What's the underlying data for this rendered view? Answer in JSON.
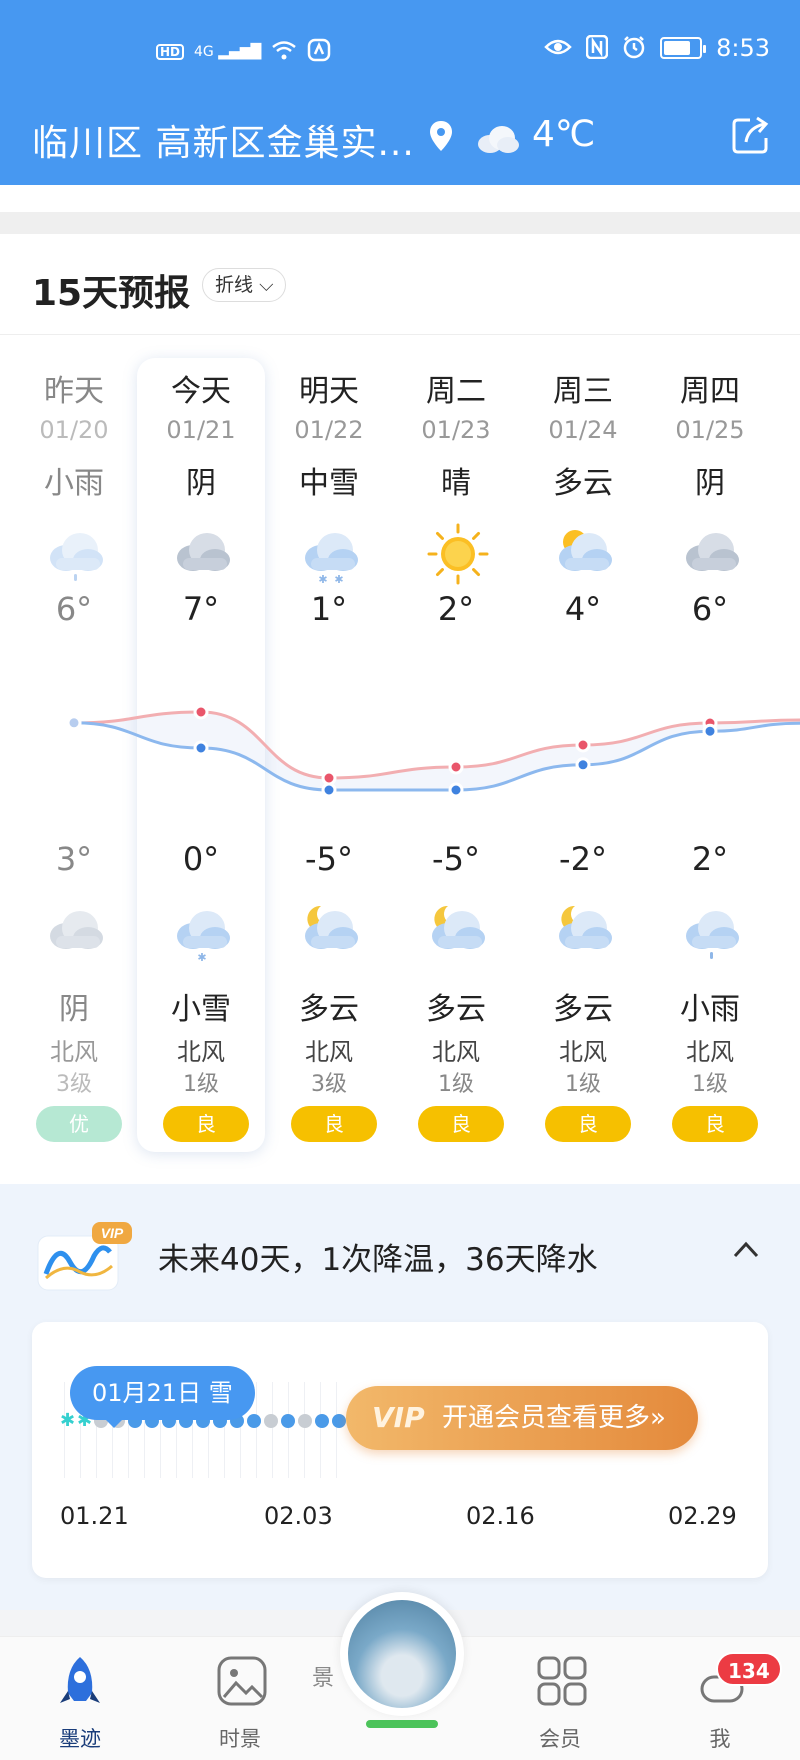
{
  "status_bar": {
    "time": "8:53",
    "left_icons": [
      "HD",
      "4G",
      "signal-icon",
      "wifi-icon",
      "vpn-icon"
    ],
    "right_icons": [
      "eye-icon",
      "nfc-icon",
      "alarm-icon",
      "battery-icon"
    ],
    "battery_level": 0.75
  },
  "header": {
    "location": "临川区 高新区金巢实...",
    "temperature": "4℃",
    "weather_icon": "cloudy-icon"
  },
  "forecast": {
    "title": "15天预报",
    "mode_label": "折线",
    "days": [
      {
        "day": "昨天",
        "date": "01/20",
        "day_cond": "小雨",
        "high": "6°",
        "low": "3°",
        "night_cond": "阴",
        "wind_dir": "北风",
        "wind_level": "3级",
        "aqi": "优",
        "day_icon": "light-rain-icon",
        "night_icon": "overcast-icon",
        "high_val": 6,
        "low_val": 3
      },
      {
        "day": "今天",
        "date": "01/21",
        "day_cond": "阴",
        "high": "7°",
        "low": "0°",
        "night_cond": "小雪",
        "wind_dir": "北风",
        "wind_level": "1级",
        "aqi": "良",
        "day_icon": "overcast-icon",
        "night_icon": "light-snow-icon",
        "high_val": 7,
        "low_val": 0
      },
      {
        "day": "明天",
        "date": "01/22",
        "day_cond": "中雪",
        "high": "1°",
        "low": "-5°",
        "night_cond": "多云",
        "wind_dir": "北风",
        "wind_level": "3级",
        "aqi": "良",
        "day_icon": "moderate-snow-icon",
        "night_icon": "partly-cloudy-night-icon",
        "high_val": 1,
        "low_val": -5
      },
      {
        "day": "周二",
        "date": "01/23",
        "day_cond": "晴",
        "high": "2°",
        "low": "-5°",
        "night_cond": "多云",
        "wind_dir": "北风",
        "wind_level": "1级",
        "aqi": "良",
        "day_icon": "sunny-icon",
        "night_icon": "partly-cloudy-night-icon",
        "high_val": 2,
        "low_val": -5
      },
      {
        "day": "周三",
        "date": "01/24",
        "day_cond": "多云",
        "high": "4°",
        "low": "-2°",
        "night_cond": "多云",
        "wind_dir": "北风",
        "wind_level": "1级",
        "aqi": "良",
        "day_icon": "partly-cloudy-day-icon",
        "night_icon": "partly-cloudy-night-icon",
        "high_val": 4,
        "low_val": -2
      },
      {
        "day": "周四",
        "date": "01/25",
        "day_cond": "阴",
        "high": "6°",
        "low": "2°",
        "night_cond": "小雨",
        "wind_dir": "北风",
        "wind_level": "1级",
        "aqi": "良",
        "day_icon": "overcast-icon",
        "night_icon": "light-rain-icon",
        "high_val": 6,
        "low_val": 2
      }
    ]
  },
  "trend40": {
    "badge": "VIP",
    "summary": "未来40天，1次降温，36天降水",
    "tooltip": "01月21日 雪",
    "vip_button_tag": "VIP",
    "vip_button": "开通会员查看更多»",
    "x_labels": [
      "01.21",
      "02.03",
      "02.16",
      "02.29"
    ]
  },
  "bottom_nav": {
    "items": [
      {
        "label": "墨迹",
        "icon": "rocket-icon",
        "active": true
      },
      {
        "label": "时景",
        "icon": "photo-icon",
        "active": false
      },
      {
        "label": "会员",
        "icon": "grid-icon",
        "active": false
      },
      {
        "label": "我",
        "icon": "profile-icon",
        "active": false
      }
    ],
    "badge_count": "134",
    "partial_label": "景"
  }
}
